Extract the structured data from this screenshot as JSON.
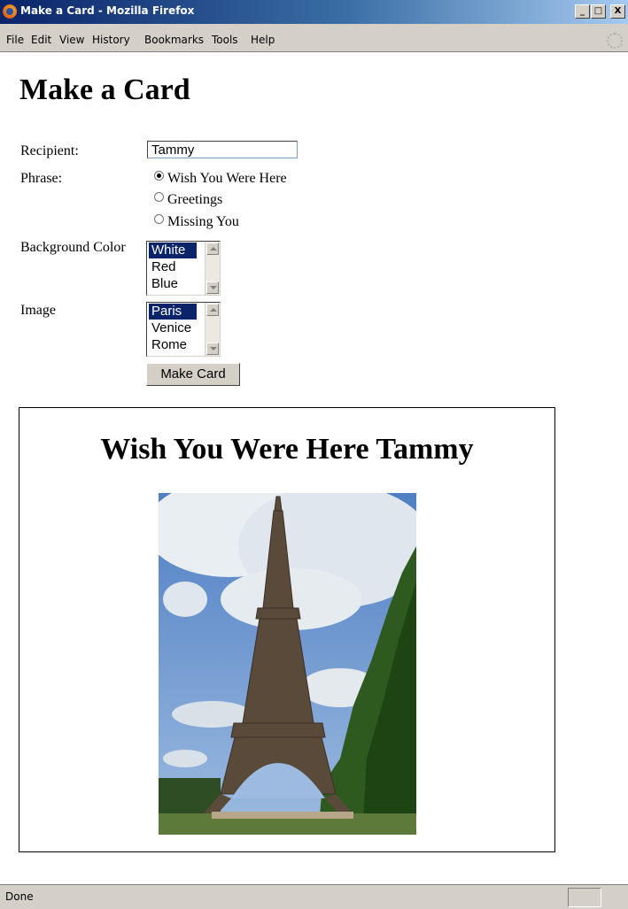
{
  "window": {
    "title": "Make a Card - Mozilla Firefox",
    "minimize": "_",
    "maximize": "□",
    "close": "X"
  },
  "menu": [
    "File",
    "Edit",
    "View",
    "History",
    "Bookmarks",
    "Tools",
    "Help"
  ],
  "page": {
    "heading": "Make a Card",
    "recipient_label": "Recipient:",
    "recipient_value": "Tammy",
    "phrase_label": "Phrase:",
    "phrases": [
      "Wish You Were Here",
      "Greetings",
      "Missing You"
    ],
    "phrase_selected": "Wish You Were Here",
    "bg_label": "Background Color",
    "bg_options": [
      "White",
      "Red",
      "Blue"
    ],
    "bg_selected": "White",
    "image_label": "Image",
    "image_options": [
      "Paris",
      "Venice",
      "Rome"
    ],
    "image_selected": "Paris",
    "submit_label": "Make Card"
  },
  "card": {
    "heading": "Wish You Were Here Tammy",
    "image_icon": "eiffel-tower-photo"
  },
  "status": {
    "text": "Done"
  },
  "colors": {
    "selection": "#0a246a",
    "chrome": "#d4d0c8"
  }
}
